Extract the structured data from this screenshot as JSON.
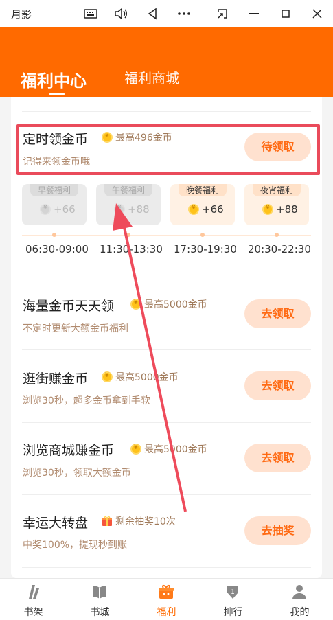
{
  "window": {
    "title": "月影",
    "icons": [
      "keyboard-icon",
      "volume-icon",
      "back-icon",
      "more-icon",
      "screen-cast-icon",
      "minimize-icon",
      "maximize-icon",
      "close-icon"
    ]
  },
  "header": {
    "tabs": [
      {
        "label": "福利中心",
        "active": true
      },
      {
        "label": "福利商城",
        "active": false
      }
    ]
  },
  "tasks": {
    "timed": {
      "title": "定时领金币",
      "badge": "最高496金币",
      "sub": "记得来领金币哦",
      "button": "待领取"
    },
    "slots": [
      {
        "label": "早餐福利",
        "amount": "+66",
        "time": "06:30-09:00",
        "active": false
      },
      {
        "label": "午餐福利",
        "amount": "+88",
        "time": "11:30-13:30",
        "active": false
      },
      {
        "label": "晚餐福利",
        "amount": "+66",
        "time": "17:30-19:30",
        "active": true
      },
      {
        "label": "夜宵福利",
        "amount": "+88",
        "time": "20:30-22:30",
        "active": true
      }
    ],
    "list": [
      {
        "title": "海量金币天天领",
        "badge": "最高5000金币",
        "sub": "不定时更新大额金币福利",
        "button": "去领取",
        "icon": "coin"
      },
      {
        "title": "逛街赚金币",
        "badge": "最高5000金币",
        "sub": "浏览30秒，超多金币拿到手软",
        "button": "去领取",
        "icon": "coin"
      },
      {
        "title": "浏览商城赚金币",
        "badge": "最高5000金币",
        "sub": "浏览30秒，领取大额金币",
        "button": "去领取",
        "icon": "coin"
      },
      {
        "title": "幸运大转盘",
        "badge": "剩余抽奖10次",
        "sub": "中奖100%，提现秒到账",
        "button": "去抽奖",
        "icon": "gift"
      }
    ]
  },
  "bottom_nav": [
    {
      "label": "书架",
      "icon": "bookshelf-icon",
      "active": false
    },
    {
      "label": "书城",
      "icon": "book-icon",
      "active": false
    },
    {
      "label": "福利",
      "icon": "gift-box-icon",
      "active": true
    },
    {
      "label": "排行",
      "icon": "ranking-icon",
      "active": false
    },
    {
      "label": "我的",
      "icon": "profile-icon",
      "active": false
    }
  ],
  "colors": {
    "brand": "#ff6a00",
    "button_bg": "#ffe1cf",
    "button_text": "#ff6a13",
    "highlight": "#ea4b5b"
  }
}
